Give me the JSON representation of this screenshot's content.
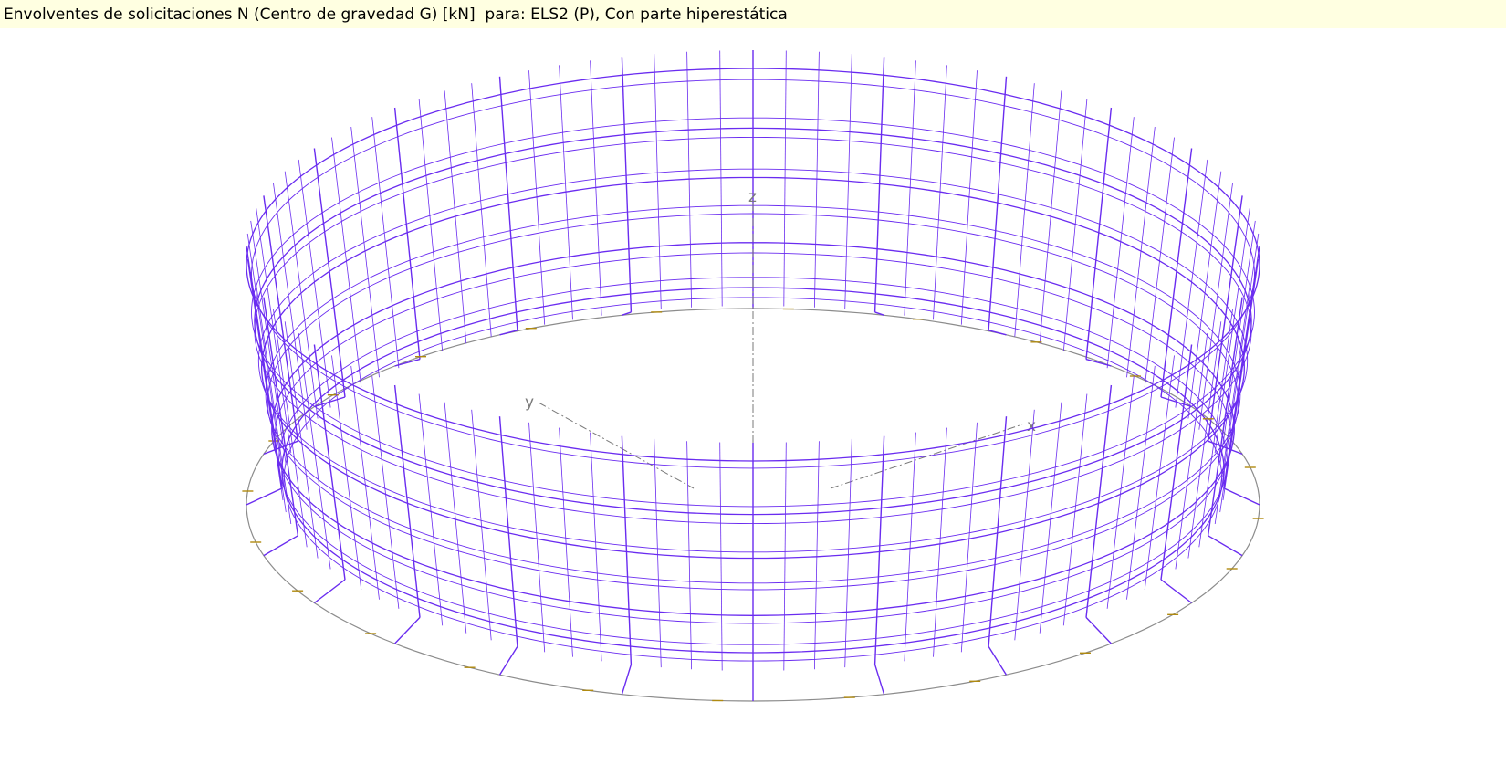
{
  "header": {
    "title": "Envolventes de solicitaciones N (Centro de gravedad G) [kN]  para: ELS2 (P), Con parte hiperestática"
  },
  "axes": {
    "x_label": "x",
    "y_label": "y",
    "z_label": "z"
  },
  "colors": {
    "diagram": "#6a2cf0",
    "structure": "#8c8c8c",
    "axes": "#7a7a7a",
    "highlight": "#b08a10",
    "title_background": "#ffffe1"
  }
}
